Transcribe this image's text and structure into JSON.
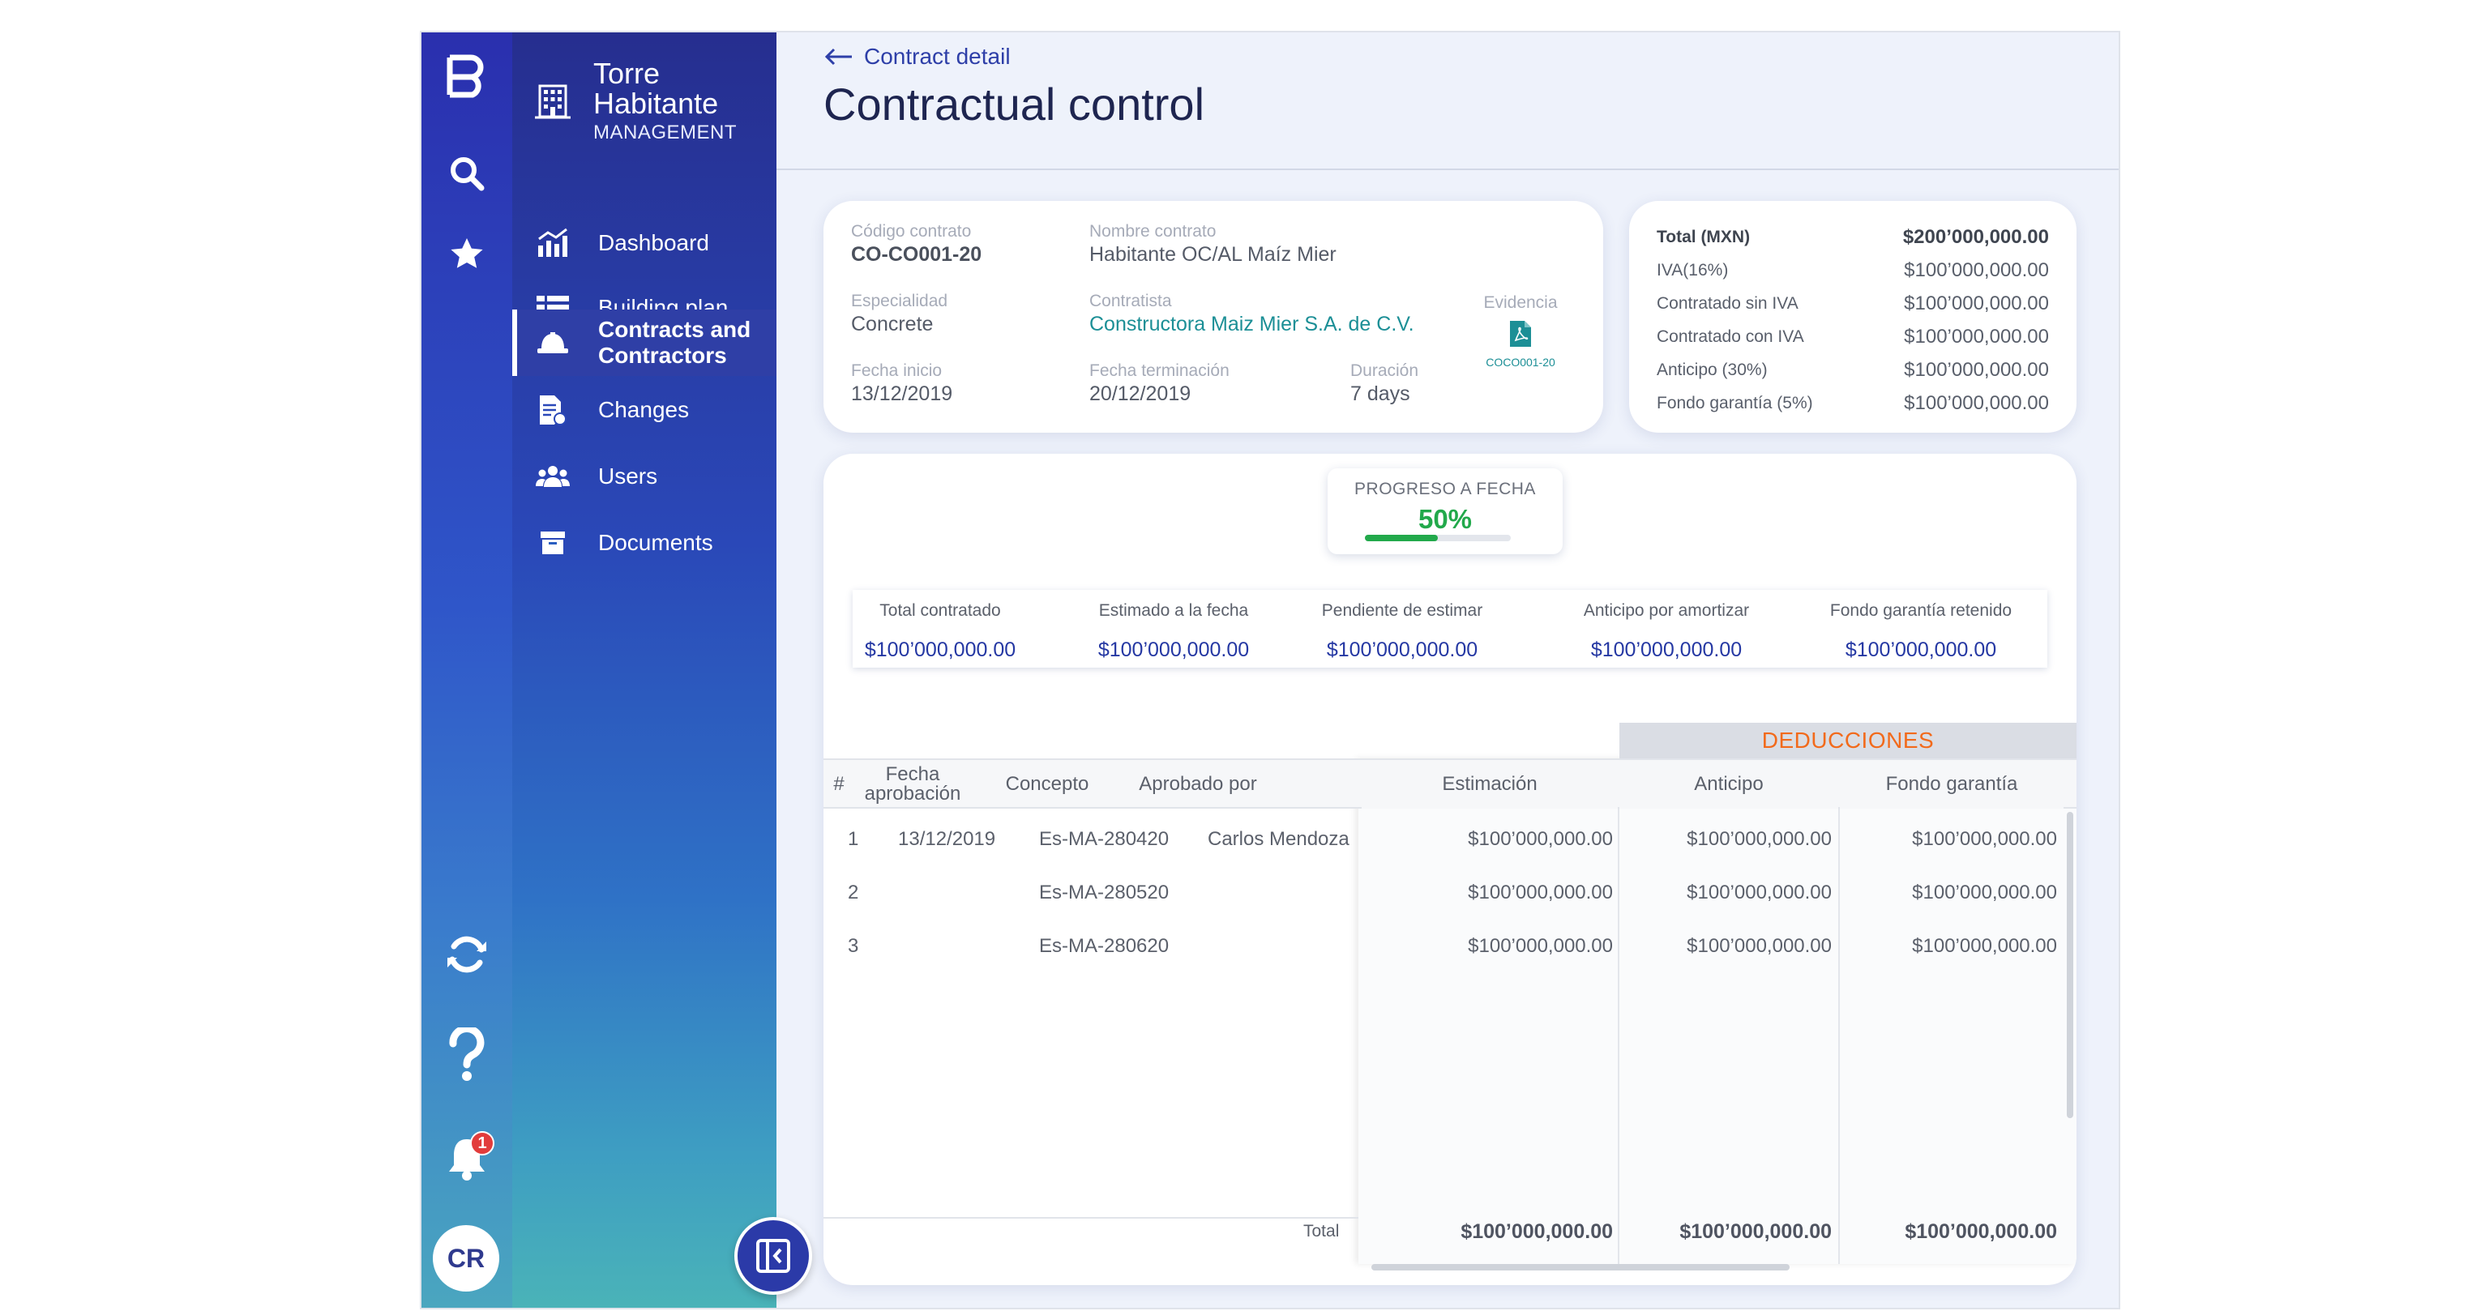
{
  "app": {
    "logo_letter": "B",
    "avatar_initials": "CR",
    "notification_count": "1"
  },
  "brand": {
    "name_line1": "Torre",
    "name_line2": "Habitante",
    "subtitle": "MANAGEMENT"
  },
  "nav": {
    "items": [
      {
        "label": "Dashboard",
        "icon": "chart-icon"
      },
      {
        "label": "Building plan",
        "icon": "list-icon"
      },
      {
        "label": "Contracts and Contractors",
        "icon": "hardhat-icon",
        "active": true
      },
      {
        "label": "Changes",
        "icon": "document-edit-icon"
      },
      {
        "label": "Users",
        "icon": "users-icon"
      },
      {
        "label": "Documents",
        "icon": "archive-icon"
      }
    ]
  },
  "header": {
    "back_label": "Contract detail",
    "title": "Contractual control"
  },
  "contract": {
    "codigo_label": "Código contrato",
    "codigo": "CO-CO001-20",
    "nombre_label": "Nombre contrato",
    "nombre": "Habitante OC/AL Maíz Mier",
    "especialidad_label": "Especialidad",
    "especialidad": "Concrete",
    "contratista_label": "Contratista",
    "contratista": "Constructora Maiz Mier S.A. de C.V.",
    "evidencia_label": "Evidencia",
    "evidencia_file": "COCO001-20",
    "inicio_label": "Fecha inicio",
    "inicio": "13/12/2019",
    "termino_label": "Fecha terminación",
    "termino": "20/12/2019",
    "duracion_label": "Duración",
    "duracion": "7 days"
  },
  "totals": [
    {
      "label": "Total (MXN)",
      "value": "$200’000,000.00"
    },
    {
      "label": "IVA(16%)",
      "value": "$100’000,000.00"
    },
    {
      "label": "Contratado sin IVA",
      "value": "$100’000,000.00"
    },
    {
      "label": "Contratado con IVA",
      "value": "$100’000,000.00"
    },
    {
      "label": "Anticipo (30%)",
      "value": "$100’000,000.00"
    },
    {
      "label": "Fondo garantía (5%)",
      "value": "$100’000,000.00"
    }
  ],
  "progress": {
    "label": "PROGRESO A FECHA",
    "value_text": "50%",
    "fraction": 0.5
  },
  "summary": [
    {
      "label": "Total contratado",
      "value": "$100’000,000.00"
    },
    {
      "label": "Estimado a la fecha",
      "value": "$100’000,000.00"
    },
    {
      "label": "Pendiente de estimar",
      "value": "$100’000,000.00"
    },
    {
      "label": "Anticipo por amortizar",
      "value": "$100’000,000.00"
    },
    {
      "label": "Fondo garantía retenido",
      "value": "$100’000,000.00"
    }
  ],
  "table": {
    "deducciones_label": "DEDUCCIONES",
    "headers": {
      "num": "#",
      "fecha_line1": "Fecha",
      "fecha_line2": "aprobación",
      "concepto": "Concepto",
      "aprobado": "Aprobado por",
      "estimacion": "Estimación",
      "anticipo": "Anticipo",
      "fondo": "Fondo garantía"
    },
    "rows": [
      {
        "num": "1",
        "fecha": "13/12/2019",
        "concepto": "Es-MA-280420",
        "aprobado": "Carlos Mendoza",
        "estimacion": "$100’000,000.00",
        "anticipo": "$100’000,000.00",
        "fondo": "$100’000,000.00"
      },
      {
        "num": "2",
        "fecha": "",
        "concepto": "Es-MA-280520",
        "aprobado": "",
        "estimacion": "$100’000,000.00",
        "anticipo": "$100’000,000.00",
        "fondo": "$100’000,000.00"
      },
      {
        "num": "3",
        "fecha": "",
        "concepto": "Es-MA-280620",
        "aprobado": "",
        "estimacion": "$100’000,000.00",
        "anticipo": "$100’000,000.00",
        "fondo": "$100’000,000.00"
      }
    ],
    "footer": {
      "label": "Total",
      "estimacion": "$100’000,000.00",
      "anticipo": "$100’000,000.00",
      "fondo": "$100’000,000.00"
    }
  },
  "colors": {
    "primary": "#2a2fae",
    "accent_green": "#22a94b",
    "accent_orange": "#f26a1b",
    "link_teal": "#1c8f96",
    "value_blue": "#2538a3"
  }
}
